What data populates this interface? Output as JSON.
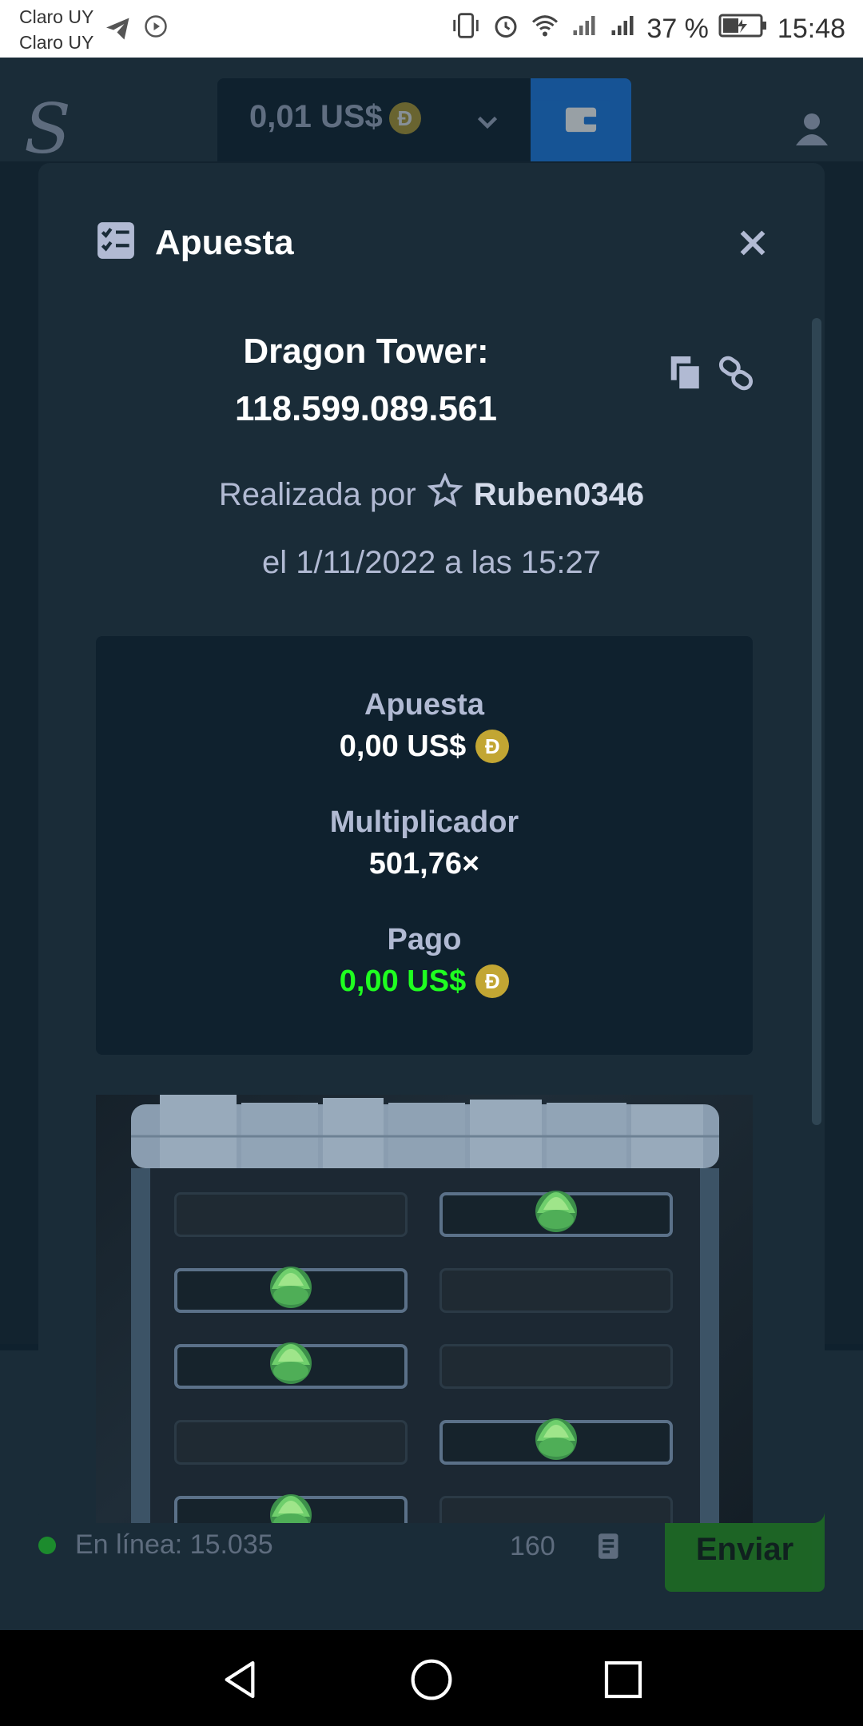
{
  "status_bar": {
    "carrier_1": "Claro UY",
    "carrier_2": "Claro UY",
    "battery": "37 %",
    "time": "15:48"
  },
  "header": {
    "balance": "0,01 US$",
    "coin_symbol": "Ð",
    "logo": "S"
  },
  "modal": {
    "title": "Apuesta",
    "game_name": "Dragon Tower:",
    "bet_id": "118.599.089.561",
    "placed_by_label": "Realizada por",
    "username": "Ruben0346",
    "date": "el 1/11/2022 a las 15:27",
    "stats": {
      "bet_label": "Apuesta",
      "bet_value": "0,00 US$",
      "multiplier_label": "Multiplicador",
      "multiplier_value": "501,76×",
      "payout_label": "Pago",
      "payout_value": "0,00 US$"
    }
  },
  "footer": {
    "online": "En línea: 15.035",
    "count": "160",
    "send_label": "Enviar"
  },
  "colors": {
    "accent_blue": "#1475e1",
    "payout_green": "#1fff20",
    "coin_gold": "#c2a633"
  }
}
